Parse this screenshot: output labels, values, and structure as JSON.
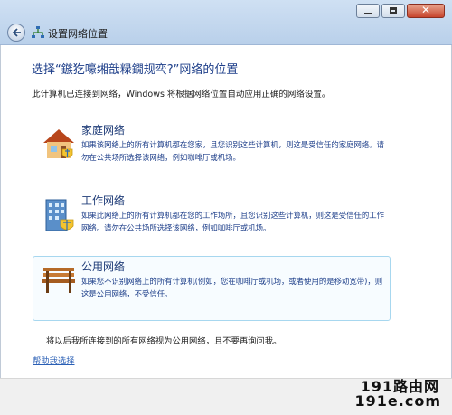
{
  "window": {
    "title": "设置网络位置"
  },
  "heading": "选择“鏃犵嚎缃戠粶鐗规亪?”网络的位置",
  "intro": "此计算机已连接到网络，Windows 将根据网络位置自动应用正确的网络设置。",
  "options": [
    {
      "title": "家庭网络",
      "desc": "如果该网络上的所有计算机都在您家，且您识别这些计算机，则这是受信任的家庭网络。请勿在公共场所选择该网络，例如咖啡厅或机场。",
      "icon": "house-icon"
    },
    {
      "title": "工作网络",
      "desc": "如果此网络上的所有计算机都在您的工作场所，且您识别这些计算机，则这是受信任的工作网络。请勿在公共场所选择该网络，例如咖啡厅或机场。",
      "icon": "office-building-icon"
    },
    {
      "title": "公用网络",
      "desc": "如果您不识别网络上的所有计算机(例如，您在咖啡厅或机场，或者使用的是移动宽带)，则这是公用网络，不受信任。",
      "icon": "park-bench-icon"
    }
  ],
  "checkbox_label": "将以后我所连接到的所有网络视为公用网络，且不要再询问我。",
  "help_link": "帮助我选择",
  "watermark": {
    "line1": "191路由网",
    "line2": "191e.com"
  }
}
